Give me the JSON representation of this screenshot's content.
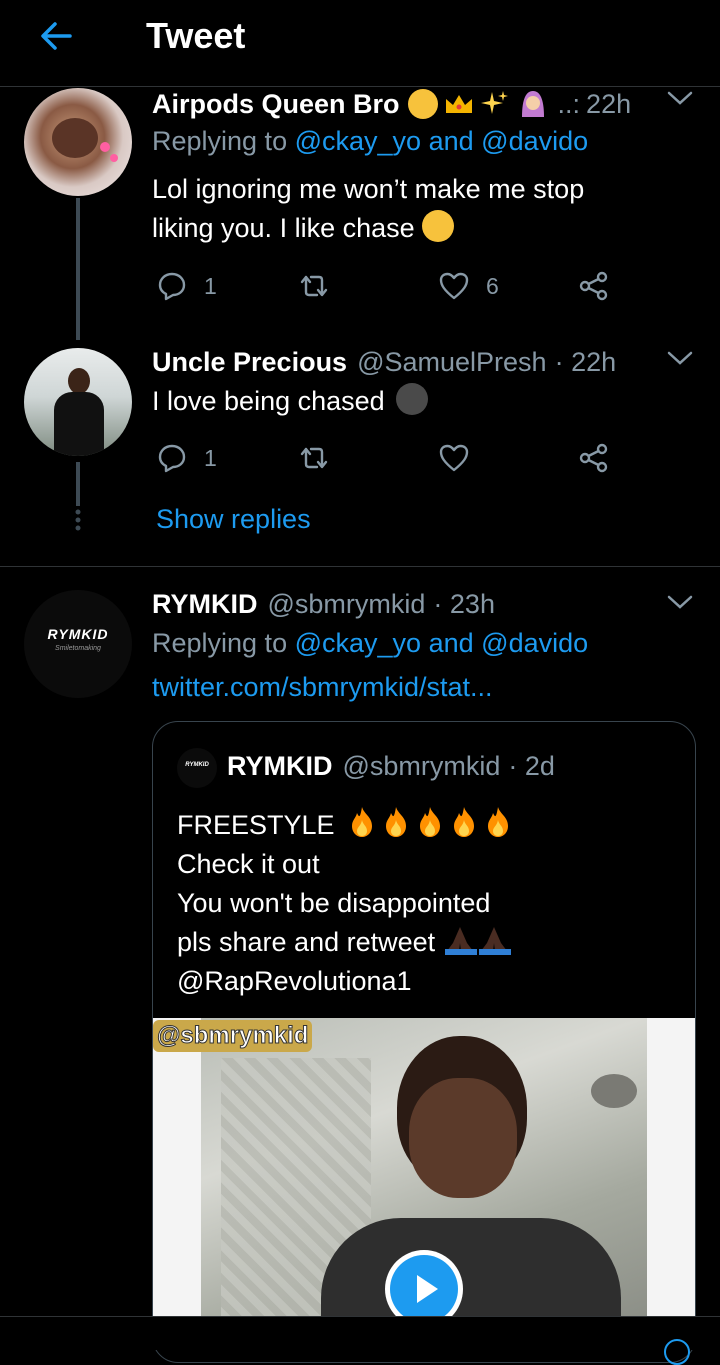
{
  "header": {
    "title": "Tweet"
  },
  "tweets": [
    {
      "display_name": "Airpods Queen Bro",
      "handle": "..:",
      "time": "22h",
      "replying_prefix": "Replying to",
      "mention1": "@ckay_yo",
      "and": "and",
      "mention2": "@davido",
      "text_line1": "Lol ignoring me won’t make me stop",
      "text_line2": "liking you. I like chase",
      "reply_count": "1",
      "like_count": "6"
    },
    {
      "display_name": "Uncle Precious",
      "handle": "@SamuelPresh",
      "time": "· 22h",
      "text": "I love being chased",
      "reply_count": "1"
    },
    {
      "display_name": "RYMKID",
      "handle": "@sbmrymkid",
      "time": "· 23h",
      "replying_prefix": "Replying to",
      "mention1": "@ckay_yo",
      "and": "and",
      "mention2": "@davido",
      "link": "twitter.com/sbmrymkid/stat...",
      "avatar_logo": "RYMKID",
      "avatar_sub": "Smiletomaking"
    }
  ],
  "show_replies": "Show replies",
  "quote": {
    "display_name": "RYMKID",
    "handle": "@sbmrymkid",
    "time": "· 2d",
    "line1": "FREESTYLE",
    "line2": "Check it out",
    "line3": "You won't be disappointed",
    "line4": "pls share and retweet",
    "line5": "@RapRevolutiona1",
    "video_watermark": "@sbmrymkid",
    "avatar_logo": "RYMKID"
  },
  "colors": {
    "accent": "#1d9bf0",
    "muted": "#8899a6",
    "background": "#000000"
  }
}
